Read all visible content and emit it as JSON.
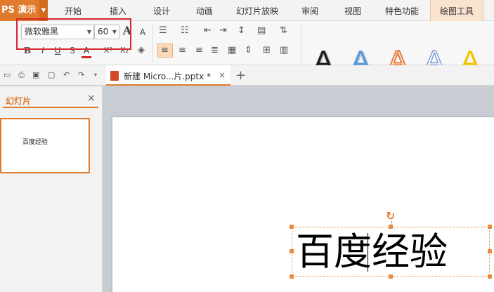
{
  "app": {
    "button_label": "PS 演示"
  },
  "menu": {
    "items": [
      "开始",
      "插入",
      "设计",
      "动画",
      "幻灯片放映",
      "审阅",
      "视图",
      "特色功能",
      "绘图工具"
    ],
    "active": "绘图工具"
  },
  "ribbon": {
    "font_name": "微软雅黑",
    "font_size": "60",
    "format_buttons": [
      "B",
      "I",
      "U",
      "S",
      "A",
      "X²",
      "X₂"
    ],
    "grow_font": "A",
    "shrink_font": "A",
    "wordart_letter": "A",
    "wordart_styles": [
      "black",
      "blue",
      "orange-outline",
      "blue-outline",
      "yellow"
    ]
  },
  "tabs": {
    "document_title": "新建 Micro...片.pptx *",
    "close": "×",
    "new_tab": "+"
  },
  "panel": {
    "title": "幻灯片",
    "close": "×",
    "thumbnail_text": "百度经验"
  },
  "slide": {
    "text_before_caret": "百度",
    "text_after_caret": "经验",
    "rotate_icon": "↻"
  },
  "colors": {
    "accent": "#e07b2d",
    "highlight_box": "#d9272e",
    "handle": "#ea8a3f"
  }
}
